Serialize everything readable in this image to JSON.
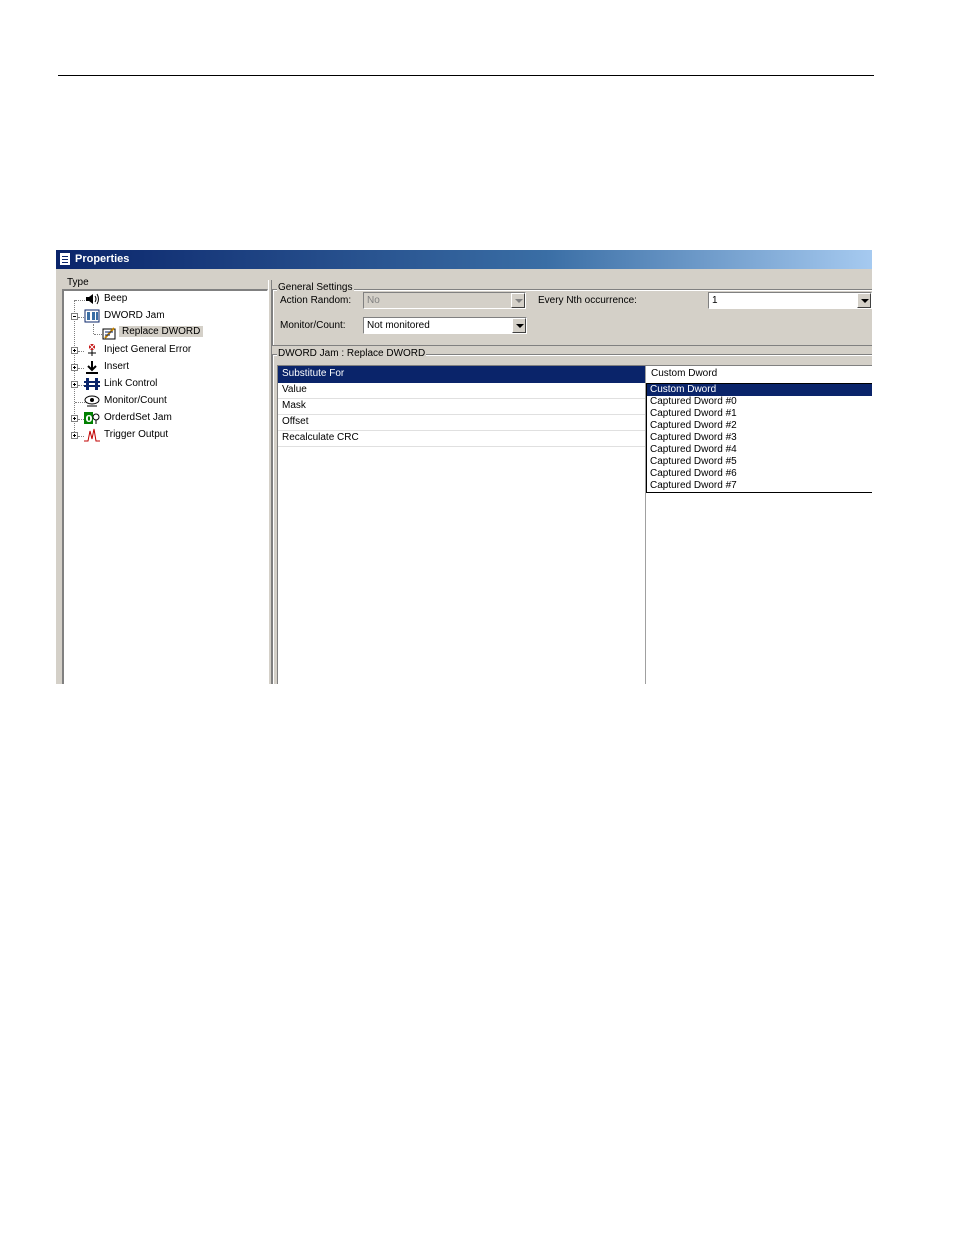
{
  "window": {
    "title": "Properties"
  },
  "tree": {
    "label": "Type",
    "items": [
      {
        "label": "Beep",
        "icon": "speaker-icon"
      },
      {
        "label": "DWORD Jam",
        "icon": "dword-jam-icon"
      },
      {
        "label": "Replace DWORD",
        "icon": "replace-dword-icon"
      },
      {
        "label": "Inject General Error",
        "icon": "inject-error-icon"
      },
      {
        "label": "Insert",
        "icon": "insert-icon"
      },
      {
        "label": "Link Control",
        "icon": "link-control-icon"
      },
      {
        "label": "Monitor/Count",
        "icon": "monitor-count-icon"
      },
      {
        "label": "OrderdSet Jam",
        "icon": "orderedset-jam-icon"
      },
      {
        "label": "Trigger Output",
        "icon": "trigger-output-icon"
      }
    ]
  },
  "general_settings": {
    "title": "General Settings",
    "action_random_label": "Action Random:",
    "action_random_value": "No",
    "every_nth_label": "Every Nth occurrence:",
    "every_nth_value": "1",
    "monitor_count_label": "Monitor/Count:",
    "monitor_count_value": "Not monitored"
  },
  "dword_group": {
    "title": "DWORD Jam : Replace DWORD",
    "rows": [
      "Substitute For",
      "Value",
      "Mask",
      "Offset",
      "Recalculate CRC"
    ],
    "current_value": "Custom Dword",
    "options": [
      "Custom Dword",
      "Captured Dword #0",
      "Captured Dword #1",
      "Captured Dword #2",
      "Captured Dword #3",
      "Captured Dword #4",
      "Captured Dword #5",
      "Captured Dword #6",
      "Captured Dword #7"
    ]
  },
  "colors": {
    "selection": "#0a246a",
    "face": "#d4d0c8"
  }
}
